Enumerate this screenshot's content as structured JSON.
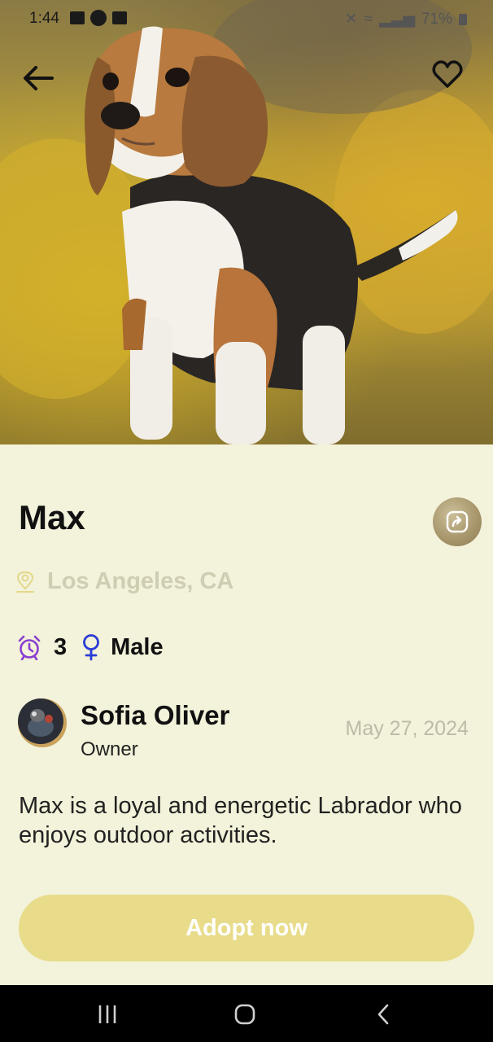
{
  "status_bar": {
    "time": "1:44",
    "battery": "71%"
  },
  "pet": {
    "name": "Max",
    "location": "Los Angeles, CA",
    "age": "3",
    "gender": "Male",
    "description": "Max is a loyal and energetic Labrador who enjoys outdoor activities."
  },
  "owner": {
    "name": "Sofia Oliver",
    "role": "Owner",
    "date": "May 27, 2024"
  },
  "actions": {
    "adopt_label": "Adopt now"
  },
  "colors": {
    "background": "#f3f2da",
    "accent": "#e8dc8a",
    "muted_text": "#cfcdb2",
    "age_icon": "#8a3fd1",
    "gender_icon": "#2a3cd6"
  },
  "icons": [
    "back-arrow-icon",
    "heart-icon",
    "share-icon",
    "location-pin-icon",
    "alarm-clock-icon",
    "female-symbol-icon"
  ]
}
